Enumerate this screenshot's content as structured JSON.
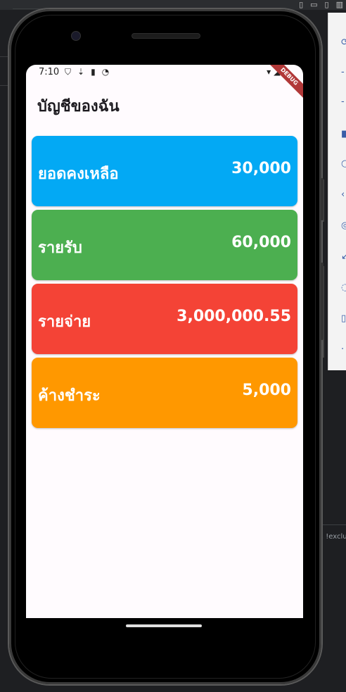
{
  "ide": {
    "bottom_text": "t, !exclu"
  },
  "status_bar": {
    "time": "7:10",
    "icons": [
      "shield-icon",
      "download-icon",
      "sd-card-icon",
      "sync-icon"
    ],
    "right_icons": [
      "wifi-icon",
      "signal-icon",
      "battery-icon"
    ],
    "debug_label": "DEBUG"
  },
  "app": {
    "title": "บัญชีของฉัน"
  },
  "cards": [
    {
      "label": "ยอดคงเหลือ",
      "value": "30,000",
      "color": "#03a9f4"
    },
    {
      "label": "รายรับ",
      "value": "60,000",
      "color": "#4caf50"
    },
    {
      "label": "รายจ่าย",
      "value": "3,000,000.55",
      "color": "#f44336"
    },
    {
      "label": "ค้างชำระ",
      "value": "5,000",
      "color": "#ff9800"
    }
  ]
}
